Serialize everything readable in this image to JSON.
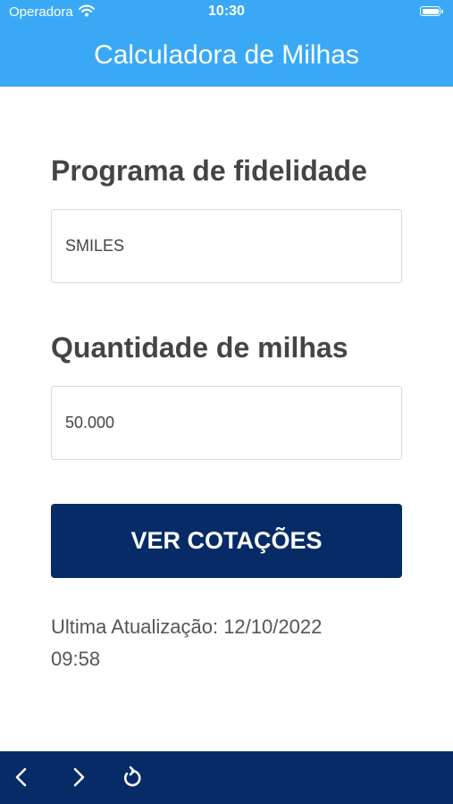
{
  "status_bar": {
    "carrier": "Operadora",
    "time": "10:30"
  },
  "header": {
    "title": "Calculadora de Milhas"
  },
  "form": {
    "program_label": "Programa de fidelidade",
    "program_value": "SMILES",
    "miles_label": "Quantidade de milhas",
    "miles_value": "50.000",
    "submit_label": "VER COTAÇÕES"
  },
  "last_update": {
    "line1": "Ultima Atualização: 12/10/2022",
    "line2": "09:58"
  },
  "bottom_bar": {
    "icons": [
      "chevron-left-icon",
      "chevron-right-icon",
      "refresh-icon"
    ]
  },
  "colors": {
    "header_bg": "#3aa9f5",
    "button_bg": "#062b66",
    "bottom_bar_bg": "#062b66"
  }
}
